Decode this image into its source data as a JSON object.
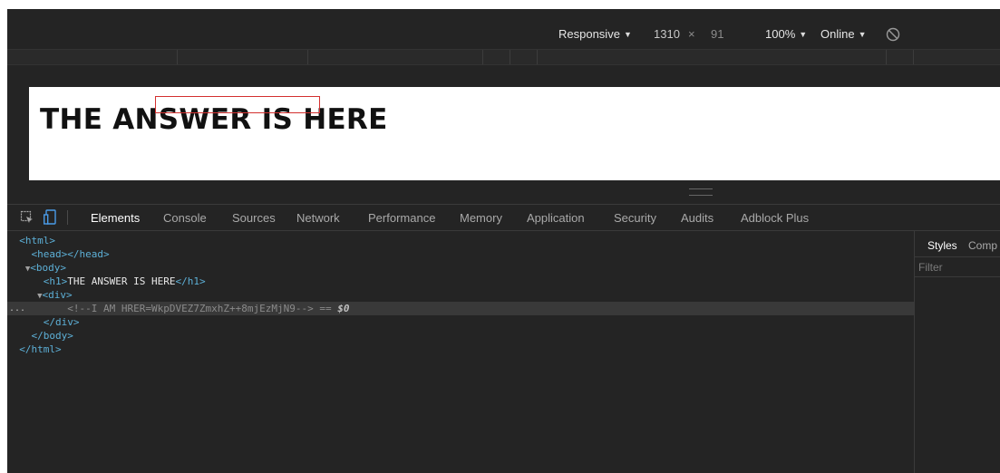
{
  "device_toolbar": {
    "preset": "Responsive",
    "width": "1310",
    "times": "×",
    "height": "91",
    "zoom": "100%",
    "throttle": "Online",
    "rotate_icon": "rotate-icon"
  },
  "page": {
    "heading": "THE ANSWER IS HERE"
  },
  "devtools": {
    "tabs": [
      "Elements",
      "Console",
      "Sources",
      "Network",
      "Performance",
      "Memory",
      "Application",
      "Security",
      "Audits",
      "Adblock Plus"
    ],
    "active_tab": "Elements",
    "icons": [
      "inspect-icon",
      "device-icon"
    ]
  },
  "dom": {
    "html_open": "<html>",
    "head": "<head></head>",
    "body_open": "<body>",
    "h1_open": "<h1>",
    "h1_text": "THE ANSWER IS HERE",
    "h1_close": "</h1>",
    "div_open": "<div>",
    "comment": "<!--I AM HRER=WkpDVEZ7ZmxhZ++8mjEzMjN9-->",
    "eq": " == ",
    "dollar": "$0",
    "div_close": "</div>",
    "body_close": "</body>",
    "html_close": "</html>",
    "ellipsis": "..."
  },
  "sidebar": {
    "tabs": [
      "Styles",
      "Comp"
    ],
    "active_tab": "Styles",
    "filter_placeholder": "Filter"
  },
  "colors": {
    "panel_bg": "#242424",
    "tag": "#5db0d7",
    "highlight": "#d3302f"
  }
}
